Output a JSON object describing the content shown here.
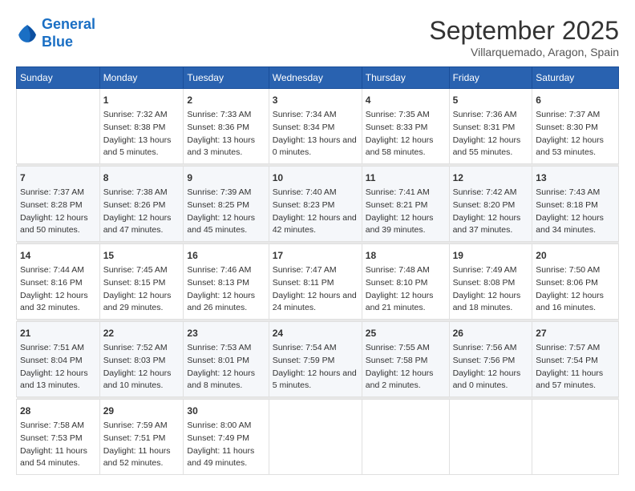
{
  "header": {
    "logo_line1": "General",
    "logo_line2": "Blue",
    "month": "September 2025",
    "location": "Villarquemado, Aragon, Spain"
  },
  "days_of_week": [
    "Sunday",
    "Monday",
    "Tuesday",
    "Wednesday",
    "Thursday",
    "Friday",
    "Saturday"
  ],
  "weeks": [
    [
      {
        "day": "",
        "sunrise": "",
        "sunset": "",
        "daylight": ""
      },
      {
        "day": "1",
        "sunrise": "Sunrise: 7:32 AM",
        "sunset": "Sunset: 8:38 PM",
        "daylight": "Daylight: 13 hours and 5 minutes."
      },
      {
        "day": "2",
        "sunrise": "Sunrise: 7:33 AM",
        "sunset": "Sunset: 8:36 PM",
        "daylight": "Daylight: 13 hours and 3 minutes."
      },
      {
        "day": "3",
        "sunrise": "Sunrise: 7:34 AM",
        "sunset": "Sunset: 8:34 PM",
        "daylight": "Daylight: 13 hours and 0 minutes."
      },
      {
        "day": "4",
        "sunrise": "Sunrise: 7:35 AM",
        "sunset": "Sunset: 8:33 PM",
        "daylight": "Daylight: 12 hours and 58 minutes."
      },
      {
        "day": "5",
        "sunrise": "Sunrise: 7:36 AM",
        "sunset": "Sunset: 8:31 PM",
        "daylight": "Daylight: 12 hours and 55 minutes."
      },
      {
        "day": "6",
        "sunrise": "Sunrise: 7:37 AM",
        "sunset": "Sunset: 8:30 PM",
        "daylight": "Daylight: 12 hours and 53 minutes."
      }
    ],
    [
      {
        "day": "7",
        "sunrise": "Sunrise: 7:37 AM",
        "sunset": "Sunset: 8:28 PM",
        "daylight": "Daylight: 12 hours and 50 minutes."
      },
      {
        "day": "8",
        "sunrise": "Sunrise: 7:38 AM",
        "sunset": "Sunset: 8:26 PM",
        "daylight": "Daylight: 12 hours and 47 minutes."
      },
      {
        "day": "9",
        "sunrise": "Sunrise: 7:39 AM",
        "sunset": "Sunset: 8:25 PM",
        "daylight": "Daylight: 12 hours and 45 minutes."
      },
      {
        "day": "10",
        "sunrise": "Sunrise: 7:40 AM",
        "sunset": "Sunset: 8:23 PM",
        "daylight": "Daylight: 12 hours and 42 minutes."
      },
      {
        "day": "11",
        "sunrise": "Sunrise: 7:41 AM",
        "sunset": "Sunset: 8:21 PM",
        "daylight": "Daylight: 12 hours and 39 minutes."
      },
      {
        "day": "12",
        "sunrise": "Sunrise: 7:42 AM",
        "sunset": "Sunset: 8:20 PM",
        "daylight": "Daylight: 12 hours and 37 minutes."
      },
      {
        "day": "13",
        "sunrise": "Sunrise: 7:43 AM",
        "sunset": "Sunset: 8:18 PM",
        "daylight": "Daylight: 12 hours and 34 minutes."
      }
    ],
    [
      {
        "day": "14",
        "sunrise": "Sunrise: 7:44 AM",
        "sunset": "Sunset: 8:16 PM",
        "daylight": "Daylight: 12 hours and 32 minutes."
      },
      {
        "day": "15",
        "sunrise": "Sunrise: 7:45 AM",
        "sunset": "Sunset: 8:15 PM",
        "daylight": "Daylight: 12 hours and 29 minutes."
      },
      {
        "day": "16",
        "sunrise": "Sunrise: 7:46 AM",
        "sunset": "Sunset: 8:13 PM",
        "daylight": "Daylight: 12 hours and 26 minutes."
      },
      {
        "day": "17",
        "sunrise": "Sunrise: 7:47 AM",
        "sunset": "Sunset: 8:11 PM",
        "daylight": "Daylight: 12 hours and 24 minutes."
      },
      {
        "day": "18",
        "sunrise": "Sunrise: 7:48 AM",
        "sunset": "Sunset: 8:10 PM",
        "daylight": "Daylight: 12 hours and 21 minutes."
      },
      {
        "day": "19",
        "sunrise": "Sunrise: 7:49 AM",
        "sunset": "Sunset: 8:08 PM",
        "daylight": "Daylight: 12 hours and 18 minutes."
      },
      {
        "day": "20",
        "sunrise": "Sunrise: 7:50 AM",
        "sunset": "Sunset: 8:06 PM",
        "daylight": "Daylight: 12 hours and 16 minutes."
      }
    ],
    [
      {
        "day": "21",
        "sunrise": "Sunrise: 7:51 AM",
        "sunset": "Sunset: 8:04 PM",
        "daylight": "Daylight: 12 hours and 13 minutes."
      },
      {
        "day": "22",
        "sunrise": "Sunrise: 7:52 AM",
        "sunset": "Sunset: 8:03 PM",
        "daylight": "Daylight: 12 hours and 10 minutes."
      },
      {
        "day": "23",
        "sunrise": "Sunrise: 7:53 AM",
        "sunset": "Sunset: 8:01 PM",
        "daylight": "Daylight: 12 hours and 8 minutes."
      },
      {
        "day": "24",
        "sunrise": "Sunrise: 7:54 AM",
        "sunset": "Sunset: 7:59 PM",
        "daylight": "Daylight: 12 hours and 5 minutes."
      },
      {
        "day": "25",
        "sunrise": "Sunrise: 7:55 AM",
        "sunset": "Sunset: 7:58 PM",
        "daylight": "Daylight: 12 hours and 2 minutes."
      },
      {
        "day": "26",
        "sunrise": "Sunrise: 7:56 AM",
        "sunset": "Sunset: 7:56 PM",
        "daylight": "Daylight: 12 hours and 0 minutes."
      },
      {
        "day": "27",
        "sunrise": "Sunrise: 7:57 AM",
        "sunset": "Sunset: 7:54 PM",
        "daylight": "Daylight: 11 hours and 57 minutes."
      }
    ],
    [
      {
        "day": "28",
        "sunrise": "Sunrise: 7:58 AM",
        "sunset": "Sunset: 7:53 PM",
        "daylight": "Daylight: 11 hours and 54 minutes."
      },
      {
        "day": "29",
        "sunrise": "Sunrise: 7:59 AM",
        "sunset": "Sunset: 7:51 PM",
        "daylight": "Daylight: 11 hours and 52 minutes."
      },
      {
        "day": "30",
        "sunrise": "Sunrise: 8:00 AM",
        "sunset": "Sunset: 7:49 PM",
        "daylight": "Daylight: 11 hours and 49 minutes."
      },
      {
        "day": "",
        "sunrise": "",
        "sunset": "",
        "daylight": ""
      },
      {
        "day": "",
        "sunrise": "",
        "sunset": "",
        "daylight": ""
      },
      {
        "day": "",
        "sunrise": "",
        "sunset": "",
        "daylight": ""
      },
      {
        "day": "",
        "sunrise": "",
        "sunset": "",
        "daylight": ""
      }
    ]
  ]
}
